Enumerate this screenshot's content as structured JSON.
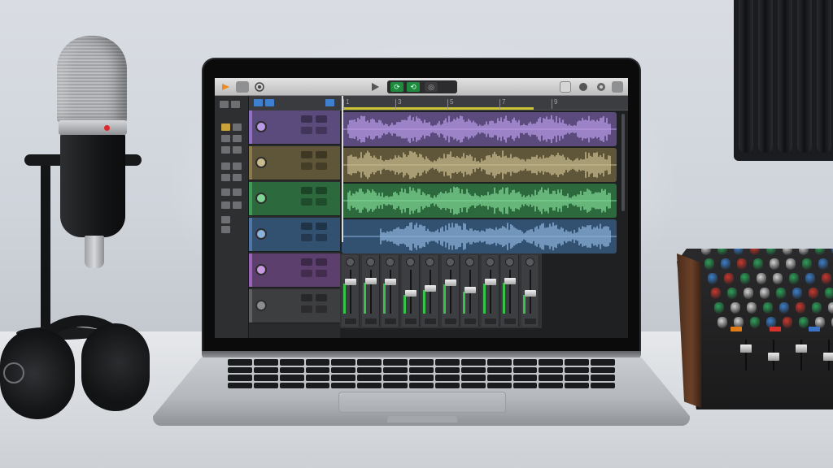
{
  "scene": {
    "description_type": "photo of a home music studio desk",
    "colors": {
      "track_purple": "#8e6fc4",
      "track_tan": "#8b7a4e",
      "track_green": "#3e9b58",
      "track_blue": "#4f78a6",
      "track_violet": "#9b64b8",
      "track_gray": "#5f6063",
      "cycle_bar": "#c9c234",
      "mic_led": "#e0262b"
    }
  },
  "daw": {
    "toolbar_icons": [
      "library-icon",
      "inspector-icon",
      "smart-controls-icon",
      "play-icon",
      "cycle-icon",
      "metronome-icon",
      "notepad-icon",
      "loops-icon",
      "browser-icon"
    ],
    "ruler_bars": [
      "1",
      "3",
      "5",
      "7",
      "9"
    ],
    "tracks": [
      {
        "name": "track-1",
        "color": "#8e6fc4",
        "region_color": "#5b4a7c",
        "wave_color": "#b99ae6"
      },
      {
        "name": "track-2",
        "color": "#8b7a4e",
        "region_color": "#5f5538",
        "wave_color": "#c8bc8e"
      },
      {
        "name": "track-3",
        "color": "#3e9b58",
        "region_color": "#2c6a3d",
        "wave_color": "#7fd695"
      },
      {
        "name": "track-4",
        "color": "#4f78a6",
        "region_color": "#32506f",
        "wave_color": "#8db3dc"
      },
      {
        "name": "track-5",
        "color": "#9b64b8",
        "region_color": "#5d3f6d",
        "wave_color": "#c89ae0"
      },
      {
        "name": "track-6",
        "color": "#5f6063",
        "region_color": "#3d3e40",
        "wave_color": "#8c8d90"
      }
    ],
    "mixer_fader_levels": [
      0.78,
      0.8,
      0.78,
      0.5,
      0.62,
      0.76,
      0.58,
      0.78,
      0.8,
      0.5
    ]
  }
}
